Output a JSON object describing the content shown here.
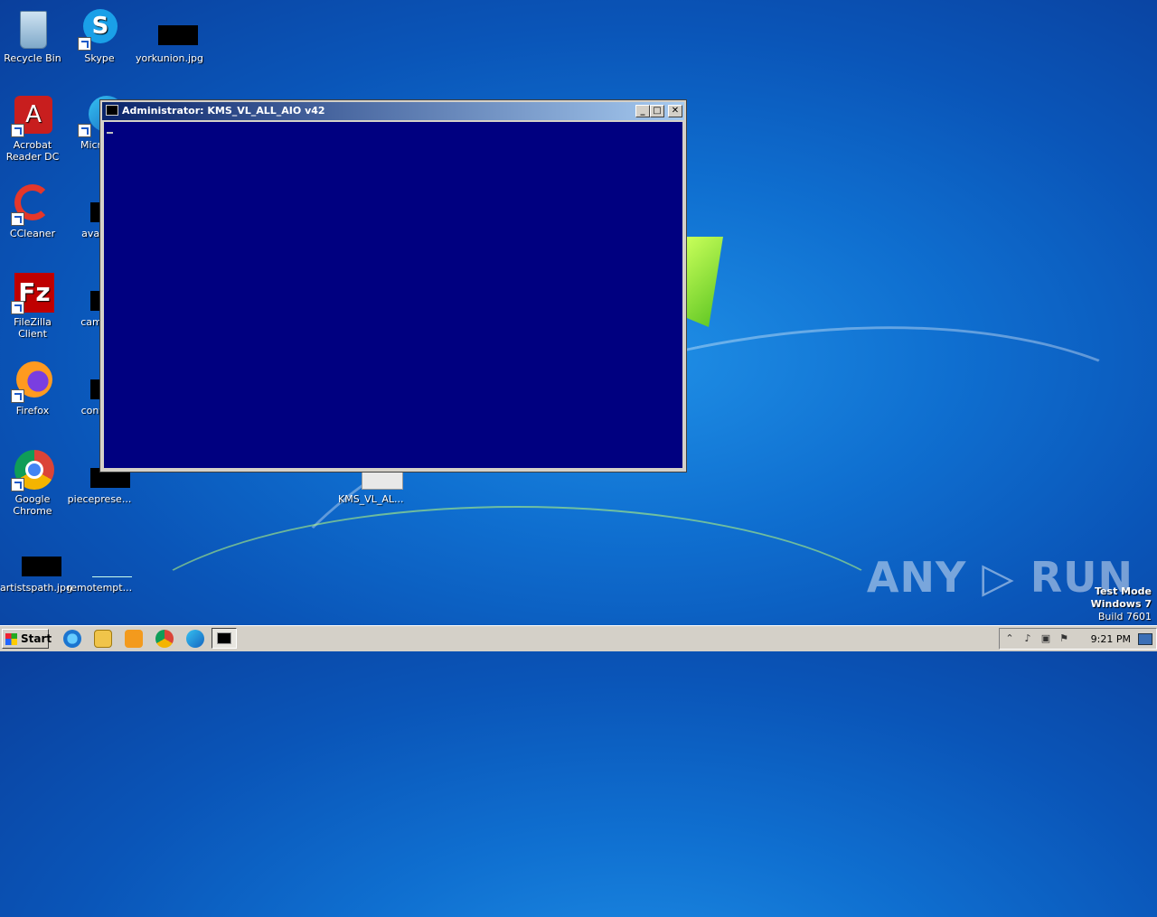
{
  "desktop": {
    "icons": [
      {
        "label": "Recycle Bin"
      },
      {
        "label": "Skype"
      },
      {
        "label": "yorkunion.jpg"
      },
      {
        "label": "Acrobat Reader DC"
      },
      {
        "label": "Microso"
      },
      {
        "label": "CCleaner"
      },
      {
        "label": "availab"
      },
      {
        "label": "FileZilla Client"
      },
      {
        "label": "camera"
      },
      {
        "label": "Firefox"
      },
      {
        "label": "contain"
      },
      {
        "label": "Google Chrome"
      },
      {
        "label": "piecepresе..."
      },
      {
        "label": "KMS_VL_AL..."
      },
      {
        "label": "artistspath.jpg"
      },
      {
        "label": "remotempt..."
      }
    ]
  },
  "window": {
    "title": "Administrator:  KMS_VL_ALL_AIO v42",
    "minimize": "_",
    "maximize": "□",
    "close": "✕"
  },
  "watermark": "ANY ▷ RUN",
  "os_notice": {
    "line1": "Test Mode",
    "line2": "Windows 7",
    "line3": "Build 7601"
  },
  "taskbar": {
    "start_label": "Start",
    "clock": "9:21 PM"
  }
}
